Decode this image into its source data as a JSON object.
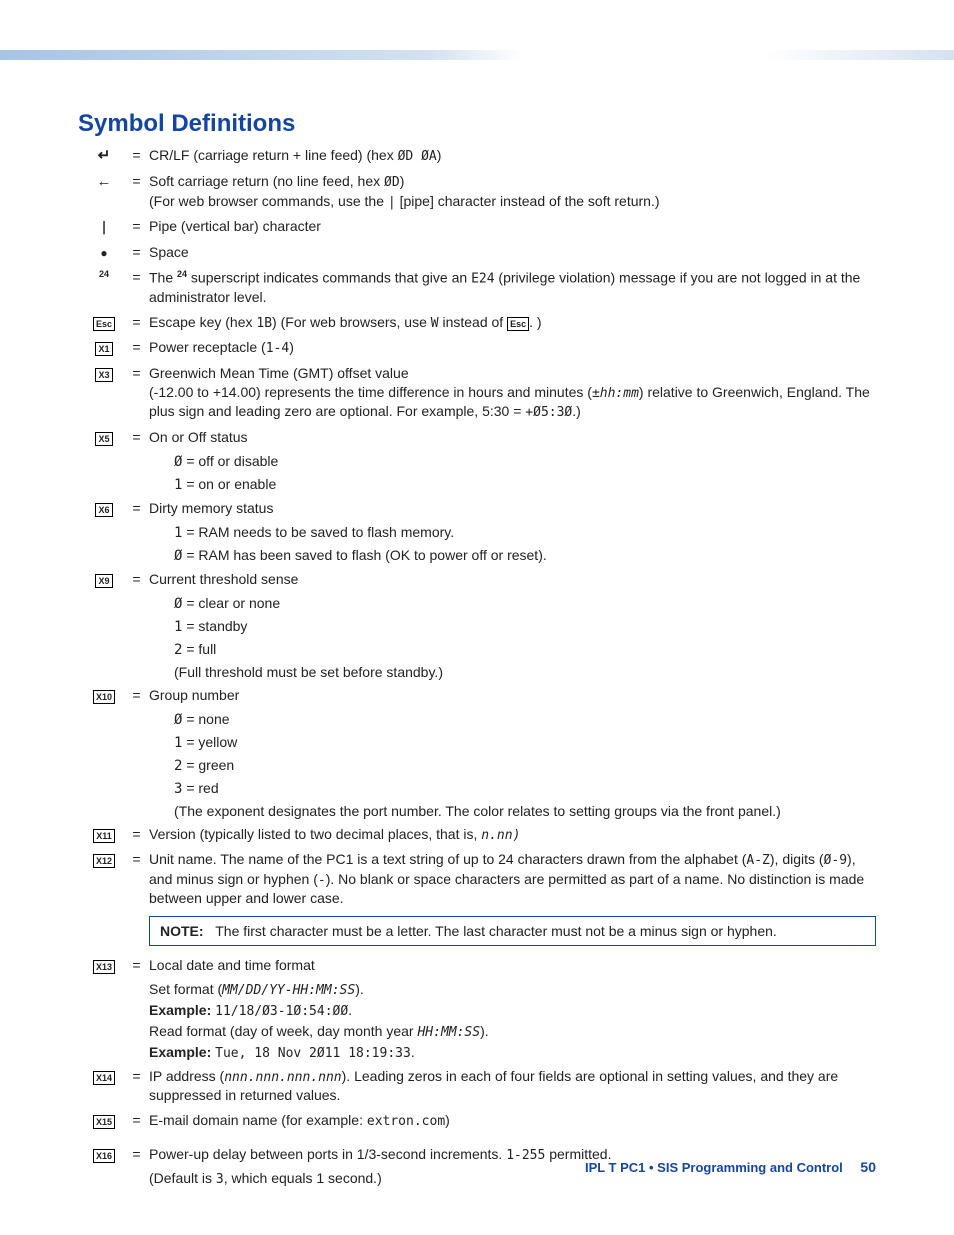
{
  "heading": "Symbol Definitions",
  "eq": "=",
  "rows": {
    "crlf": {
      "sym": "↵",
      "text": "CR/LF (carriage return + line feed) (hex ",
      "code": "ØD ØA",
      "tail": ")"
    },
    "softcr": {
      "sym": "←",
      "text": "Soft carriage return (no line feed, hex ",
      "code": "ØD",
      "tail": ")",
      "line2": "(For web browser commands, use the ",
      "pipe": "|",
      "line2b": " [pipe] character instead of the soft return.)"
    },
    "pipe": {
      "sym": "|",
      "text": "Pipe (vertical bar) character"
    },
    "space": {
      "sym": "●",
      "text": "Space"
    },
    "s24": {
      "sym": "24",
      "text": "The ",
      "code": "E24",
      "tail": " (privilege violation) message if you are not logged in at the administrator level.",
      "mid": " superscript indicates commands that give an "
    },
    "esc": {
      "sym": "Esc",
      "text": "Escape key (hex ",
      "code": "1B",
      "mid": ") (For web browsers, use ",
      "w": "W",
      "mid2": " instead of ",
      "tail": ". )"
    },
    "x1": {
      "sym": "X1",
      "text": "Power receptacle (",
      "code": "1-4",
      "tail": ")"
    },
    "x3": {
      "sym": "X3",
      "text": "Greenwich Mean Time (GMT) offset value",
      "l2a": "(-12.00 to +14.00) represents the time difference in hours and minutes (",
      "code": "±hh:mm",
      "l2b": ") relative to Greenwich, England. The plus sign and leading zero are optional. For example, 5:30 = ",
      "code2": "+Ø5:3Ø",
      "l2c": ".)"
    },
    "x5": {
      "sym": "X5",
      "text": "On or Off status",
      "o0": "Ø",
      "o0t": " = off or disable",
      "o1": "1",
      "o1t": " = on or enable"
    },
    "x6": {
      "sym": "X6",
      "text": "Dirty memory status",
      "o1": "1",
      "o1t": " = RAM needs to be saved to flash memory.",
      "o0": "Ø",
      "o0t": " = RAM has been saved to flash (OK to power off or reset)."
    },
    "x9": {
      "sym": "X9",
      "text": "Current threshold sense",
      "o0": "Ø",
      "o0t": " = clear or none",
      "o1": "1",
      "o1t": " = standby",
      "o2": "2",
      "o2t": " = full",
      "note": "(Full threshold must be set before standby.)"
    },
    "x10": {
      "sym": "X10",
      "text": "Group number",
      "o0": "Ø",
      "o0t": " = none",
      "o1": "1",
      "o1t": " = yellow",
      "o2": "2",
      "o2t": " = green",
      "o3": "3",
      "o3t": " = red",
      "note": "(The exponent designates the port number. The color relates to setting groups via the front panel.)"
    },
    "x11": {
      "sym": "X11",
      "text": "Version (typically listed to two decimal places, that is, ",
      "code": "n.nn)"
    },
    "x12": {
      "sym": "X12",
      "text": "Unit name. The name of the PC1 is a text string of up to 24 characters drawn from the alphabet (",
      "c1": "A-Z",
      "m1": "), digits (",
      "c2": "Ø-9",
      "m2": "), and minus sign or hyphen (",
      "c3": "-",
      "m3": "). No blank or space characters are permitted as part of a name. No distinction is made between upper and lower case."
    },
    "note": {
      "label": "NOTE:",
      "text": "The first character must be a letter. The last character must not be a minus sign or hyphen."
    },
    "x13": {
      "sym": "X13",
      "text": "Local date and time format",
      "l2": "Set format (",
      "code": "MM/DD/YY-HH:MM:SS",
      "l2b": ").",
      "ex1l": "Example: ",
      "ex1": "11/18/Ø3-1Ø:54:ØØ",
      "ex1t": ".",
      "l3": "Read format (day of week, day month year ",
      "code2": "HH:MM:SS",
      "l3b": ").",
      "ex2l": "Example: ",
      "ex2": "Tue, 18 Nov 2Ø11 18:19:33",
      "ex2t": "."
    },
    "x14": {
      "sym": "X14",
      "text": "IP address (",
      "code": "nnn.nnn.nnn.nnn",
      "tail": "). Leading zeros in each of four fields are optional in setting values, and they are suppressed in returned values."
    },
    "x15": {
      "sym": "X15",
      "text": "E-mail domain name (for example: ",
      "code": "extron.com",
      "tail": ")"
    },
    "x16": {
      "sym": "X16",
      "text": " Power-up delay between ports in 1/3-second increments. ",
      "code": "1-255",
      "tail": " permitted.",
      "l2": "(Default is ",
      "c2": "3",
      "l2b": ", which equals 1 second.)"
    }
  },
  "footer": {
    "title": "IPL T PC1 • SIS Programming and Control",
    "page": "50"
  }
}
